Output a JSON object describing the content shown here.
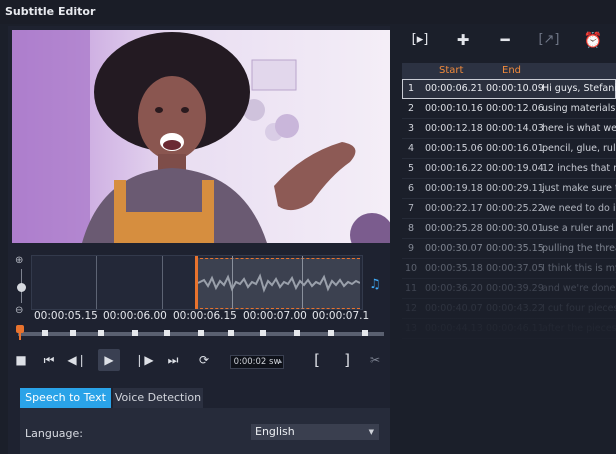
{
  "window": {
    "title": "Subtitle Editor"
  },
  "timeline": {
    "ruler": [
      "00:00:05.15",
      "00:00:06.00",
      "00:00:06.15",
      "00:00:07.00",
      "00:00:07.1"
    ]
  },
  "transport": {
    "timecode": "0:00:02 sw"
  },
  "tabs": {
    "active": "Speech to Text",
    "inactive": "Voice Detection"
  },
  "settings": {
    "language_label": "Language:",
    "language_value": "English"
  },
  "subtitle_list": {
    "headers": {
      "start": "Start",
      "end": "End"
    },
    "rows": [
      {
        "n": "1",
        "start": "00:00:06.21",
        "end": "00:00:10.09",
        "text": "Hi guys, Stefanie"
      },
      {
        "n": "2",
        "start": "00:00:10.16",
        "end": "00:00:12.06",
        "text": "using materials t"
      },
      {
        "n": "3",
        "start": "00:00:12.18",
        "end": "00:00:14.03",
        "text": "here is what we"
      },
      {
        "n": "4",
        "start": "00:00:15.06",
        "end": "00:00:16.01",
        "text": "pencil, glue, rule"
      },
      {
        "n": "5",
        "start": "00:00:16.22",
        "end": "00:00:19.04",
        "text": "12 inches that m"
      },
      {
        "n": "6",
        "start": "00:00:19.18",
        "end": "00:00:29.11",
        "text": "just make sure t"
      },
      {
        "n": "7",
        "start": "00:00:22.17",
        "end": "00:00:25.22",
        "text": "we need to do is"
      },
      {
        "n": "8",
        "start": "00:00:25.28",
        "end": "00:00:30.01",
        "text": "use a ruler and d"
      },
      {
        "n": "9",
        "start": "00:00:30.07",
        "end": "00:00:35.15",
        "text": "pulling the threa"
      },
      {
        "n": "10",
        "start": "00:00:35.18",
        "end": "00:00:37.05",
        "text": "I think this is my"
      },
      {
        "n": "11",
        "start": "00:00:36.20",
        "end": "00:00:39.29",
        "text": "and we're done"
      },
      {
        "n": "12",
        "start": "00:00:40.07",
        "end": "00:00:43.22",
        "text": "I cut four pieces"
      },
      {
        "n": "13",
        "start": "00:00:44.13",
        "end": "00:00:46.11",
        "text": "after the pieces"
      }
    ]
  },
  "colors": {
    "accent": "#2aa3e8",
    "marker": "#e8732e",
    "header_text": "#f08a3c"
  }
}
